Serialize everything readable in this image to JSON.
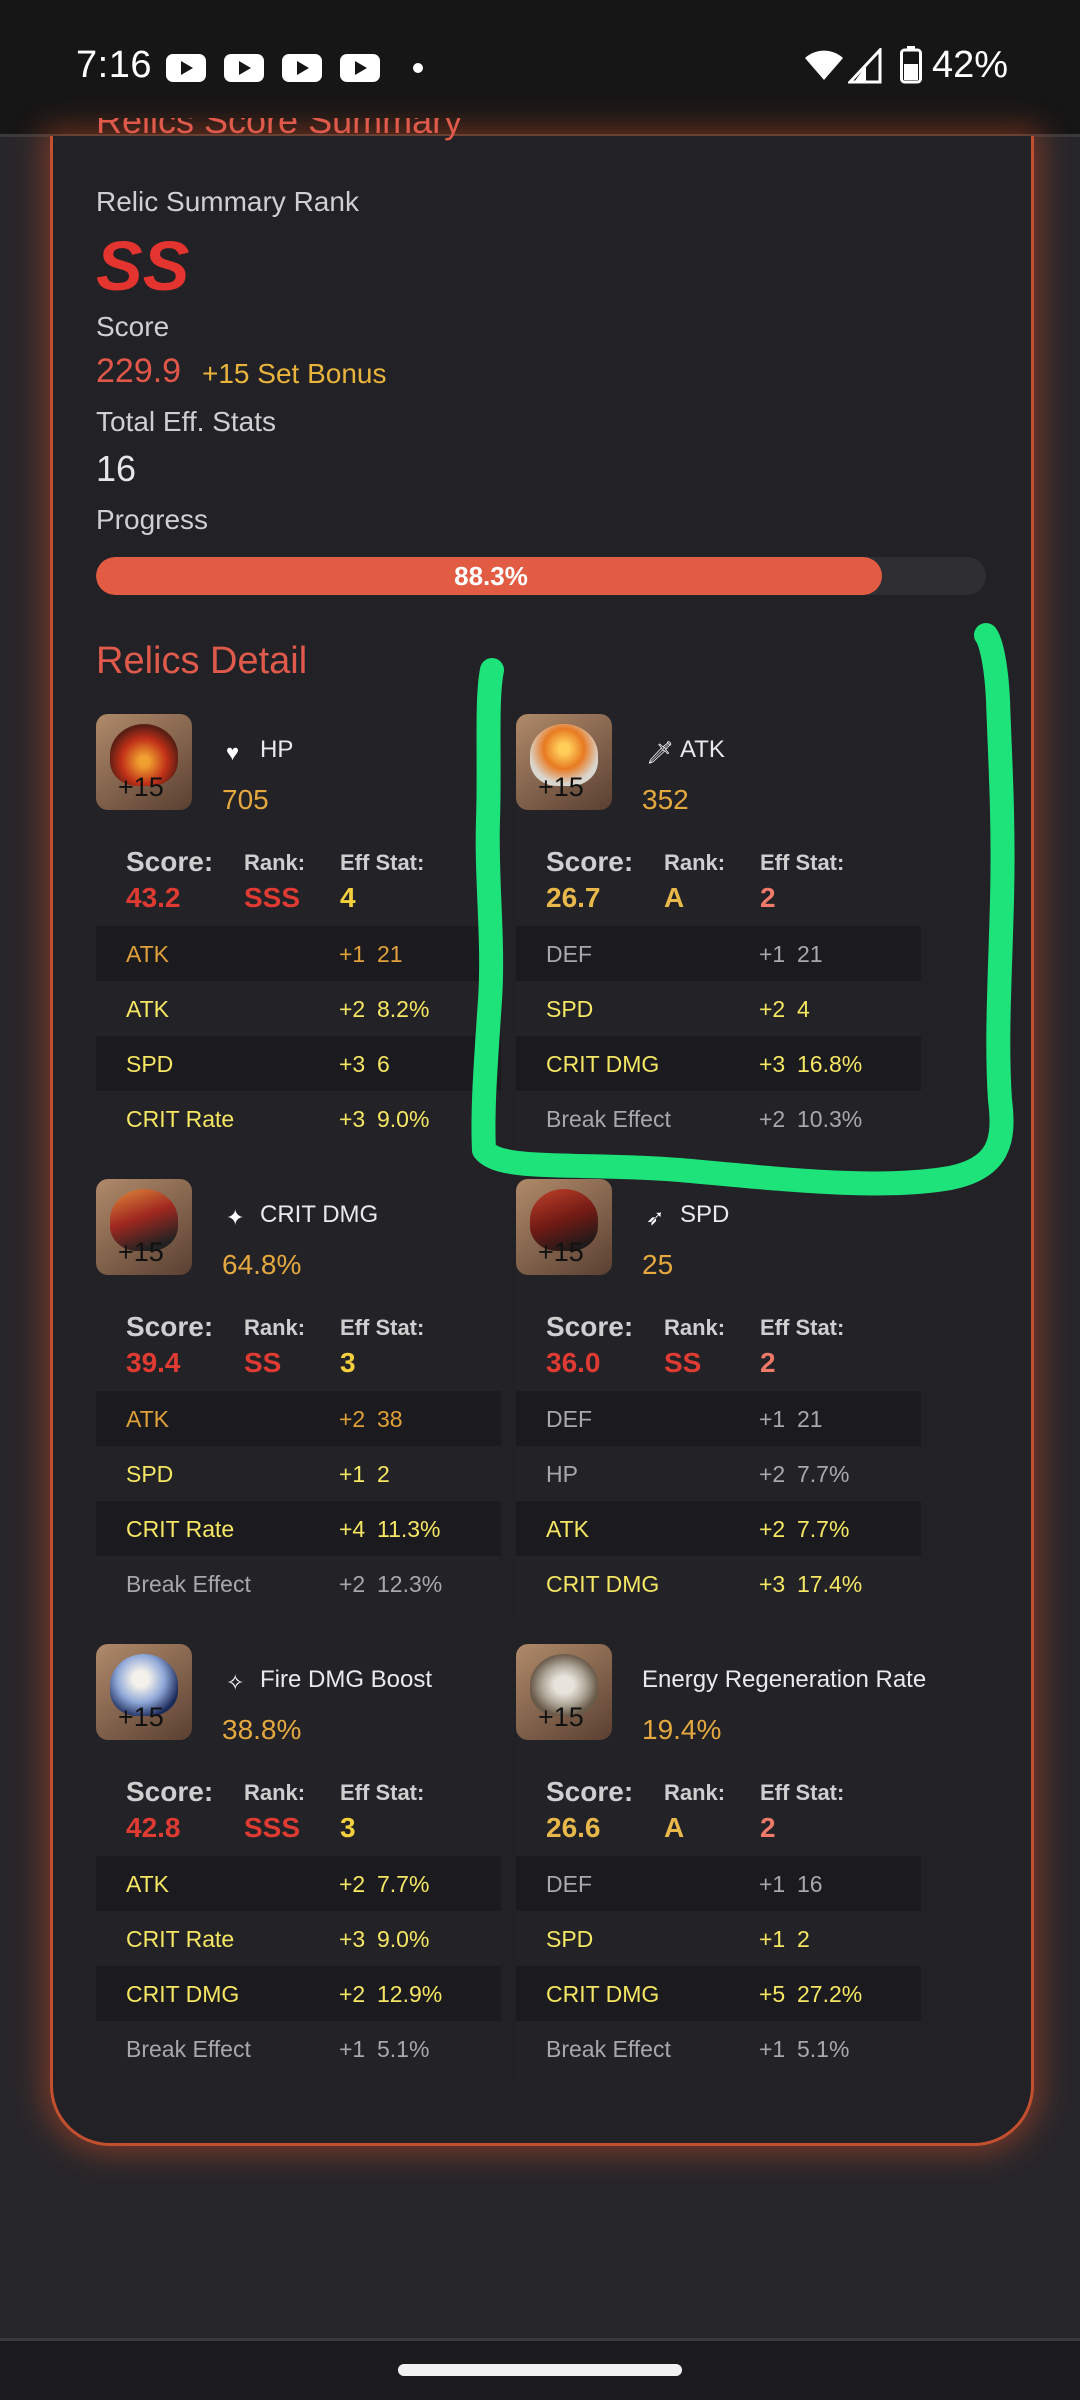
{
  "status": {
    "time": "7:16",
    "battery": "42%"
  },
  "summary": {
    "title": "Relics Score Summary",
    "rank_label": "Relic Summary Rank",
    "rank": "SS",
    "score_label": "Score",
    "score": "229.9",
    "set_bonus": "+15 Set Bonus",
    "eff_label": "Total Eff. Stats",
    "eff_value": "16",
    "progress_label": "Progress",
    "progress_text": "88.3%",
    "progress_value": 0.883
  },
  "detail_title": "Relics Detail",
  "headers": {
    "score": "Score:",
    "rank": "Rank:",
    "eff": "Eff Stat:"
  },
  "relics": [
    {
      "level": "+15",
      "main_name": "HP",
      "main_value": "705",
      "score": "43.2",
      "rank": "SSS",
      "eff": "4",
      "subs": [
        {
          "name": "ATK",
          "count": "+1",
          "value": "21"
        },
        {
          "name": "ATK",
          "count": "+2",
          "value": "8.2%"
        },
        {
          "name": "SPD",
          "count": "+3",
          "value": "6"
        },
        {
          "name": "CRIT Rate",
          "count": "+3",
          "value": "9.0%"
        }
      ]
    },
    {
      "level": "+15",
      "main_name": "ATK",
      "main_value": "352",
      "score": "26.7",
      "rank": "A",
      "eff": "2",
      "subs": [
        {
          "name": "DEF",
          "count": "+1",
          "value": "21"
        },
        {
          "name": "SPD",
          "count": "+2",
          "value": "4"
        },
        {
          "name": "CRIT DMG",
          "count": "+3",
          "value": "16.8%"
        },
        {
          "name": "Break Effect",
          "count": "+2",
          "value": "10.3%"
        }
      ]
    },
    {
      "level": "+15",
      "main_name": "CRIT DMG",
      "main_value": "64.8%",
      "score": "39.4",
      "rank": "SS",
      "eff": "3",
      "subs": [
        {
          "name": "ATK",
          "count": "+2",
          "value": "38"
        },
        {
          "name": "SPD",
          "count": "+1",
          "value": "2"
        },
        {
          "name": "CRIT Rate",
          "count": "+4",
          "value": "11.3%"
        },
        {
          "name": "Break Effect",
          "count": "+2",
          "value": "12.3%"
        }
      ]
    },
    {
      "level": "+15",
      "main_name": "SPD",
      "main_value": "25",
      "score": "36.0",
      "rank": "SS",
      "eff": "2",
      "subs": [
        {
          "name": "DEF",
          "count": "+1",
          "value": "21"
        },
        {
          "name": "HP",
          "count": "+2",
          "value": "7.7%"
        },
        {
          "name": "ATK",
          "count": "+2",
          "value": "7.7%"
        },
        {
          "name": "CRIT DMG",
          "count": "+3",
          "value": "17.4%"
        }
      ]
    },
    {
      "level": "+15",
      "main_name": "Fire DMG Boost",
      "main_value": "38.8%",
      "score": "42.8",
      "rank": "SSS",
      "eff": "3",
      "subs": [
        {
          "name": "ATK",
          "count": "+2",
          "value": "7.7%"
        },
        {
          "name": "CRIT Rate",
          "count": "+3",
          "value": "9.0%"
        },
        {
          "name": "CRIT DMG",
          "count": "+2",
          "value": "12.9%"
        },
        {
          "name": "Break Effect",
          "count": "+1",
          "value": "5.1%"
        }
      ]
    },
    {
      "level": "+15",
      "main_name": "Energy Regeneration Rate",
      "main_value": "19.4%",
      "score": "26.6",
      "rank": "A",
      "eff": "2",
      "subs": [
        {
          "name": "DEF",
          "count": "+1",
          "value": "16"
        },
        {
          "name": "SPD",
          "count": "+1",
          "value": "2"
        },
        {
          "name": "CRIT DMG",
          "count": "+5",
          "value": "27.2%"
        },
        {
          "name": "Break Effect",
          "count": "+1",
          "value": "5.1%"
        }
      ]
    }
  ]
}
